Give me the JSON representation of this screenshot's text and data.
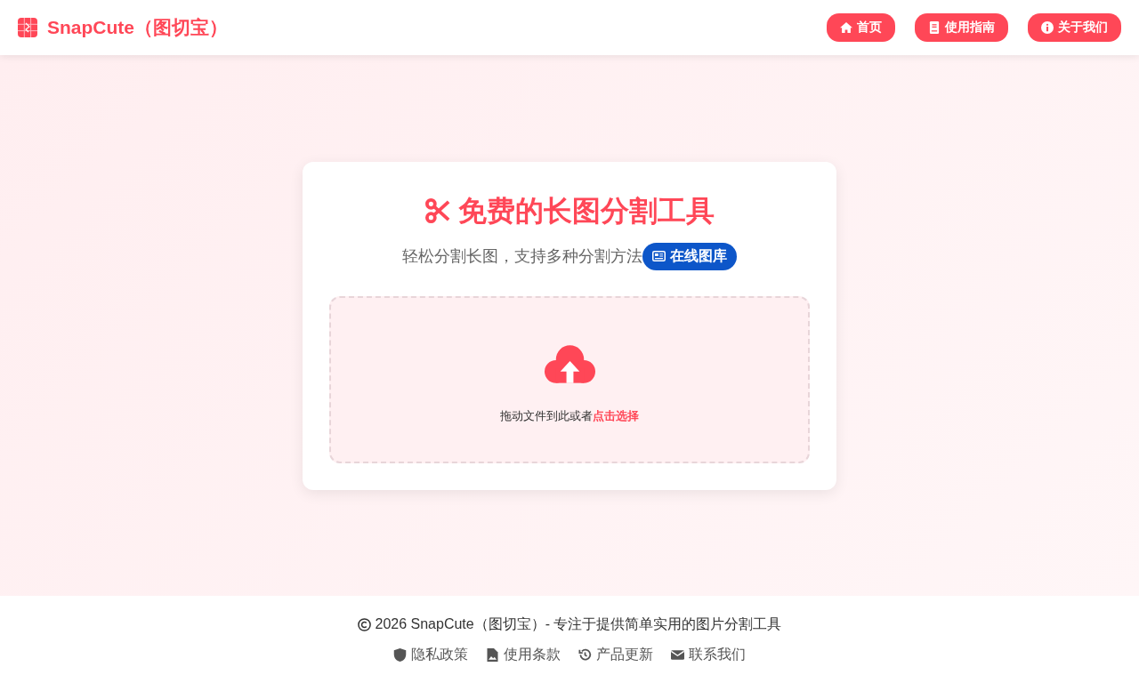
{
  "header": {
    "brand": "SnapCute（图切宝）",
    "nav": [
      {
        "label": "首页"
      },
      {
        "label": "使用指南"
      },
      {
        "label": "关于我们"
      }
    ]
  },
  "hero": {
    "title": "免费的长图分割工具",
    "subtitle": "轻松分割长图，支持多种分割方法",
    "badge": "在线图库"
  },
  "upload": {
    "prompt": "拖动文件到此或者",
    "link": "点击选择"
  },
  "footer": {
    "copyright": "2026 SnapCute（图切宝）- 专注于提供简单实用的图片分割工具",
    "links": [
      {
        "label": "隐私政策"
      },
      {
        "label": "使用条款"
      },
      {
        "label": "产品更新"
      },
      {
        "label": "联系我们"
      }
    ]
  }
}
